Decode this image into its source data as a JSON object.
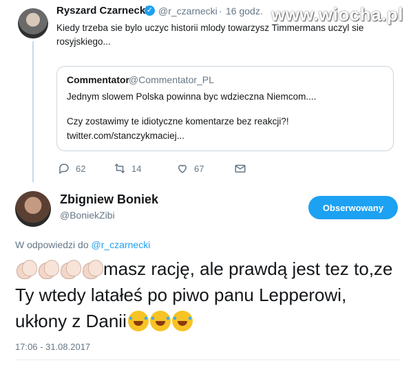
{
  "watermark": "www.wiocha.pl",
  "tweet1": {
    "name": "Ryszard Czarnecki",
    "handle": "@r_czarnecki",
    "separator": "·",
    "time": "16 godz.",
    "text": "Kiedy trzeba sie bylo uczyc historii mlody towarzysz Timmermans uczyl sie rosyjskiego...",
    "quote": {
      "name": "Commentator",
      "handle": "@Commentator_PL",
      "line1": "Jednym slowem Polska powinna byc wdzieczna Niemcom....",
      "line2": "Czy zostawimy te idiotyczne komentarze bez reakcji?!",
      "line3": "twitter.com/stanczykmaciej..."
    },
    "actions": {
      "replies": "62",
      "retweets": "14",
      "likes": "67"
    }
  },
  "tweet2": {
    "name": "Zbigniew Boniek",
    "handle": "@BoniekZibi",
    "follow_label": "Obserwowany",
    "reply_prefix": "W odpowiedzi do",
    "reply_handle": "@r_czarnecki",
    "text": "masz rację, ale prawdą jest tez to,ze Ty wtedy latałeś po piwo panu Lepperowi, ukłony z Danii",
    "timestamp": "17:06 - 31.08.2017",
    "leading_emoji": [
      "clapping-hands",
      "clapping-hands",
      "clapping-hands",
      "clapping-hands"
    ],
    "trailing_emoji": [
      "face-with-tears-of-joy",
      "face-with-tears-of-joy",
      "face-with-tears-of-joy"
    ]
  },
  "icons": [
    "reply-icon",
    "retweet-icon",
    "like-icon",
    "direct-message-icon",
    "verified-badge-icon"
  ],
  "colors": {
    "accent": "#1da1f2",
    "secondary_text": "#657786",
    "border": "#ccd6dd"
  }
}
